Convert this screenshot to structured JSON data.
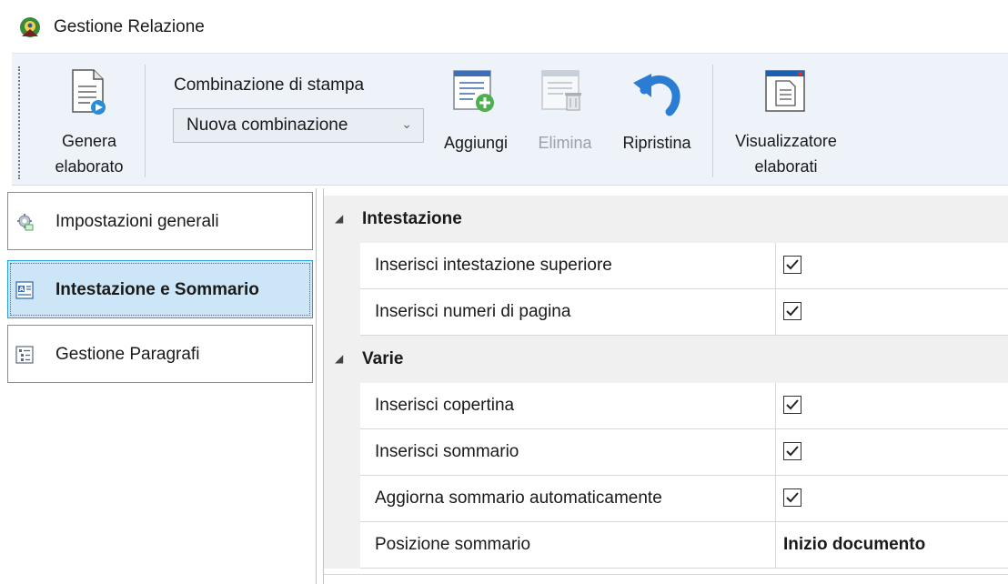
{
  "window": {
    "title": "Gestione Relazione",
    "app_icon": "app-logo-icon"
  },
  "ribbon": {
    "genera": {
      "label_line1": "Genera",
      "label_line2": "elaborato",
      "icon": "document-generate-icon"
    },
    "combination_group_label": "Combinazione di stampa",
    "combination_select": {
      "value": "Nuova combinazione"
    },
    "aggiungi": {
      "label": "Aggiungi",
      "icon": "add-item-icon",
      "enabled": true
    },
    "elimina": {
      "label": "Elimina",
      "icon": "delete-item-icon",
      "enabled": false
    },
    "ripristina": {
      "label": "Ripristina",
      "icon": "undo-icon",
      "enabled": true
    },
    "visualizzatore": {
      "label_line1": "Visualizzatore",
      "label_line2": "elaborati",
      "icon": "viewer-icon"
    }
  },
  "nav": {
    "items": [
      {
        "label": "Impostazioni generali",
        "icon": "settings-gear-icon",
        "selected": false
      },
      {
        "label": "Intestazione e Sommario",
        "icon": "header-summary-icon",
        "selected": true
      },
      {
        "label": "Gestione Paragrafi",
        "icon": "paragraphs-list-icon",
        "selected": false
      }
    ]
  },
  "properties": {
    "categories": [
      {
        "name": "Intestazione",
        "rows": [
          {
            "name": "Inserisci intestazione superiore",
            "checked": true
          },
          {
            "name": "Inserisci numeri di pagina",
            "checked": true
          }
        ]
      },
      {
        "name": "Varie",
        "rows": [
          {
            "name": "Inserisci copertina",
            "checked": true
          },
          {
            "name": "Inserisci sommario",
            "checked": true
          },
          {
            "name": "Aggiorna sommario automaticamente",
            "checked": true
          },
          {
            "name": "Posizione sommario",
            "value": "Inizio documento"
          }
        ]
      }
    ]
  },
  "colors": {
    "ribbon_bg": "#eef3fa",
    "selected_nav_bg": "#cde6f7",
    "selected_nav_border": "#26a0da",
    "category_bg": "#f0f0f0",
    "undo_arrow": "#2b7cd3"
  }
}
